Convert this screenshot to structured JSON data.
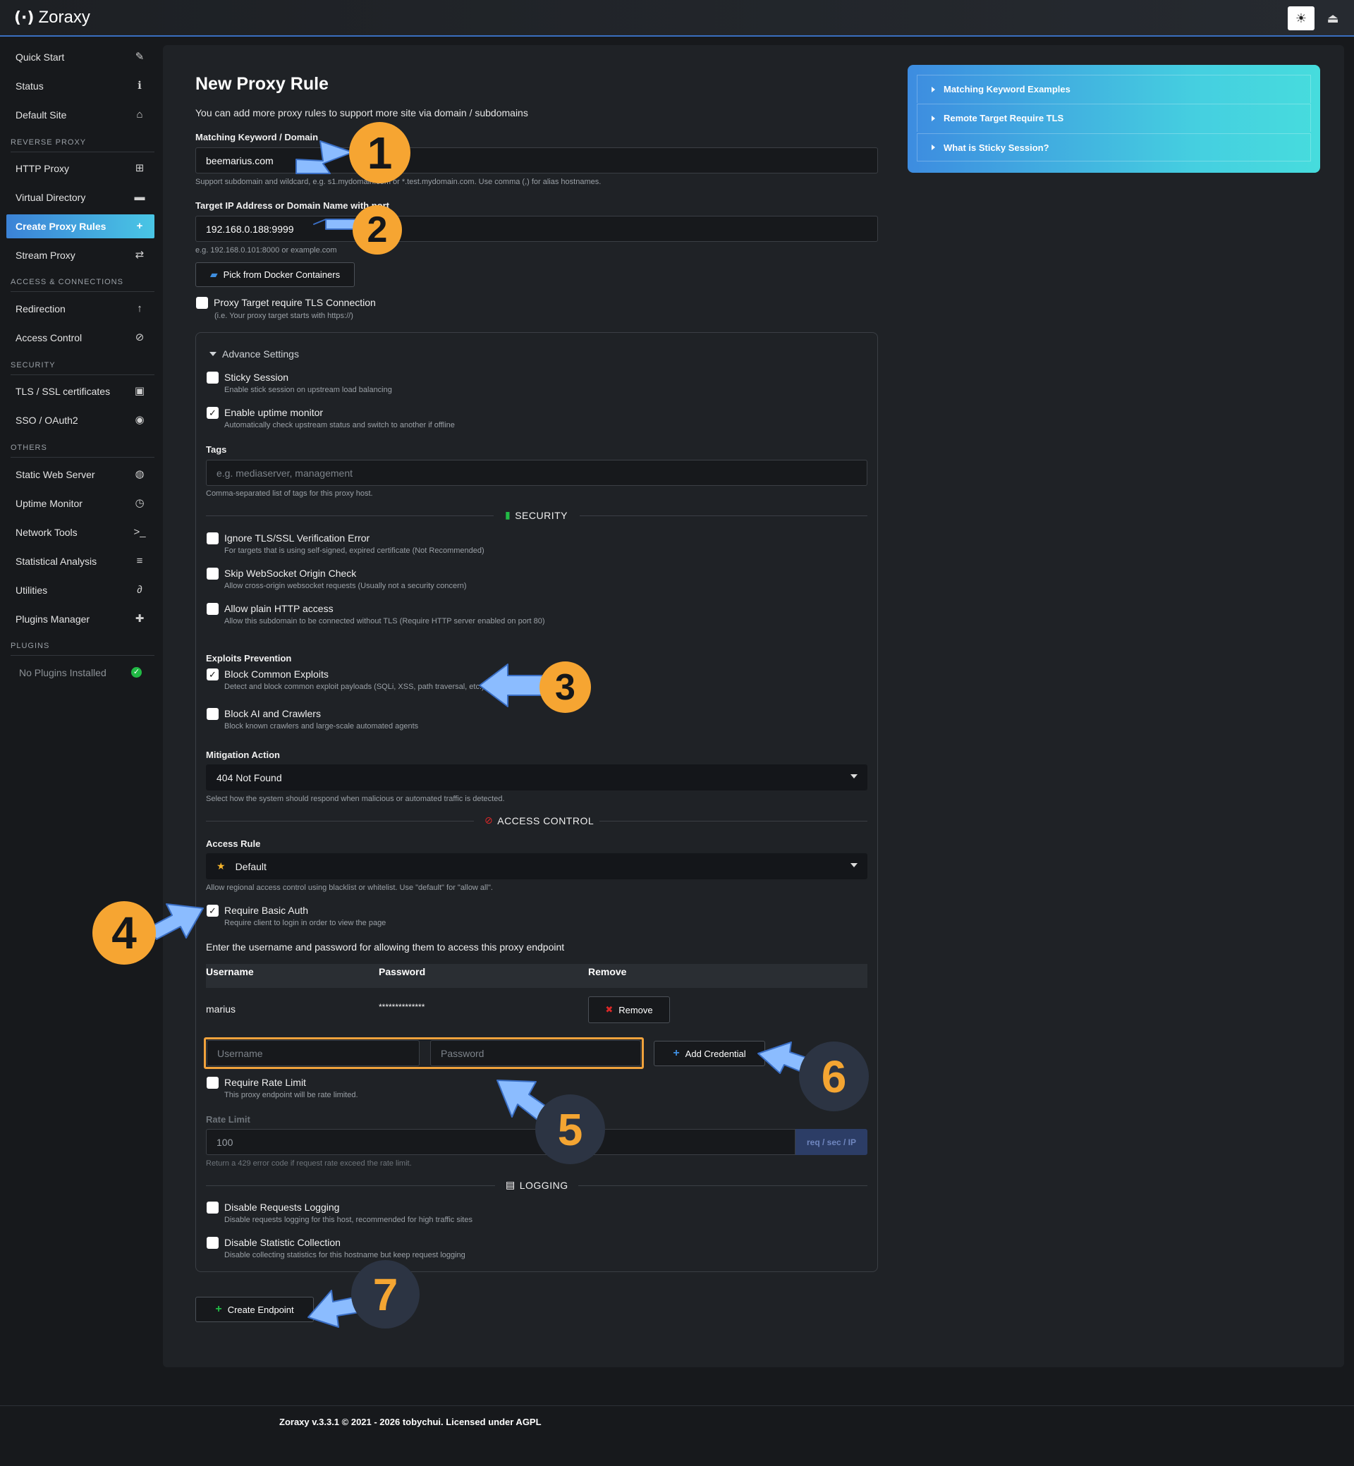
{
  "app": {
    "logo": "(·)",
    "name": "Zoraxy"
  },
  "header": {
    "theme_icon": "sun-icon",
    "logout_icon": "logout-icon"
  },
  "sidebar": {
    "items": [
      {
        "label": "Quick Start",
        "icon": "wand-icon",
        "glyph": "✎"
      },
      {
        "label": "Status",
        "icon": "info-icon",
        "glyph": "ℹ"
      },
      {
        "label": "Default Site",
        "icon": "home-icon",
        "glyph": "⌂"
      },
      {
        "label": "HTTP Proxy",
        "icon": "sitemap-icon",
        "glyph": "⊞"
      },
      {
        "label": "Virtual Directory",
        "icon": "folder-icon",
        "glyph": "▬"
      },
      {
        "label": "Create Proxy Rules",
        "icon": "plus-square-icon",
        "glyph": "+"
      },
      {
        "label": "Stream Proxy",
        "icon": "exchange-icon",
        "glyph": "⇄"
      },
      {
        "label": "Redirection",
        "icon": "level-up-icon",
        "glyph": "↑"
      },
      {
        "label": "Access Control",
        "icon": "ban-icon",
        "glyph": "⊘"
      },
      {
        "label": "TLS / SSL certificates",
        "icon": "lock-icon",
        "glyph": "▣"
      },
      {
        "label": "SSO / OAuth2",
        "icon": "user-circle-icon",
        "glyph": "◉"
      },
      {
        "label": "Static Web Server",
        "icon": "globe-icon",
        "glyph": "◍"
      },
      {
        "label": "Uptime Monitor",
        "icon": "clock-icon",
        "glyph": "◷"
      },
      {
        "label": "Network Tools",
        "icon": "terminal-icon",
        "glyph": ">_"
      },
      {
        "label": "Statistical Analysis",
        "icon": "database-icon",
        "glyph": "≡"
      },
      {
        "label": "Utilities",
        "icon": "paperclip-icon",
        "glyph": "∂"
      },
      {
        "label": "Plugins Manager",
        "icon": "puzzle-icon",
        "glyph": "✚"
      }
    ],
    "sections": [
      "REVERSE PROXY",
      "ACCESS & CONNECTIONS",
      "SECURITY",
      "OTHERS",
      "PLUGINS"
    ],
    "no_plugins": "No Plugins Installed"
  },
  "form": {
    "title": "New Proxy Rule",
    "subtitle": "You can add more proxy rules to support more site via domain / subdomains",
    "domain_label": "Matching Keyword / Domain",
    "domain_value": "beemarius.com",
    "domain_hint": "Support subdomain and wildcard, e.g. s1.mydomain.com or *.test.mydomain.com. Use comma (,) for alias hostnames.",
    "target_label": "Target IP Address or Domain Name with port",
    "target_value": "192.168.0.188:9999",
    "target_hint": "e.g. 192.168.0.101:8000 or example.com",
    "docker_button": "Pick from Docker Containers",
    "tls_label": "Proxy Target require TLS Connection",
    "tls_hint": "(i.e. Your proxy target starts with https://)",
    "advanced": {
      "header": "Advance Settings",
      "sticky_label": "Sticky Session",
      "sticky_hint": "Enable stick session on upstream load balancing",
      "uptime_label": "Enable uptime monitor",
      "uptime_hint": "Automatically check upstream status and switch to another if offline",
      "tags_label": "Tags",
      "tags_placeholder": "e.g. mediaserver, management",
      "tags_hint": "Comma-separated list of tags for this proxy host.",
      "security_title": "SECURITY",
      "ignore_tls_label": "Ignore TLS/SSL Verification Error",
      "ignore_tls_hint": "For targets that is using self-signed, expired certificate (Not Recommended)",
      "skip_ws_label": "Skip WebSocket Origin Check",
      "skip_ws_hint": "Allow cross-origin websocket requests (Usually not a security concern)",
      "plain_http_label": "Allow plain HTTP access",
      "plain_http_hint": "Allow this subdomain to be connected without TLS (Require HTTP server enabled on port 80)",
      "exploits_title": "Exploits Prevention",
      "block_exploits_label": "Block Common Exploits",
      "block_exploits_hint": "Detect and block common exploit payloads (SQLi, XSS, path traversal, etc.)",
      "block_ai_label": "Block AI and Crawlers",
      "block_ai_hint": "Block known crawlers and large-scale automated agents",
      "mitigation_label": "Mitigation Action",
      "mitigation_value": "404 Not Found",
      "mitigation_hint": "Select how the system should respond when malicious or automated traffic is detected.",
      "access_title": "ACCESS CONTROL",
      "access_rule_label": "Access Rule",
      "access_rule_value": "Default",
      "access_rule_hint": "Allow regional access control using blacklist or whitelist. Use \"default\" for \"allow all\".",
      "basic_auth_label": "Require Basic Auth",
      "basic_auth_hint": "Require client to login in order to view the page",
      "cred_intro": "Enter the username and password for allowing them to access this proxy endpoint",
      "cred_headers": [
        "Username",
        "Password",
        "Remove"
      ],
      "cred_rows": [
        {
          "username": "marius",
          "password": "**************",
          "remove": "Remove"
        }
      ],
      "username_placeholder": "Username",
      "password_placeholder": "Password",
      "add_credential": "Add Credential",
      "rate_limit_label": "Require Rate Limit",
      "rate_limit_hint": "This proxy endpoint will be rate limited.",
      "rate_label": "Rate Limit",
      "rate_value": "100",
      "rate_unit": "req / sec / IP",
      "rate_hint": "Return a 429 error code if request rate exceed the rate limit.",
      "logging_title": "LOGGING",
      "disable_logging_label": "Disable Requests Logging",
      "disable_logging_hint": "Disable requests logging for this host, recommended for high traffic sites",
      "disable_stats_label": "Disable Statistic Collection",
      "disable_stats_hint": "Disable collecting statistics for this hostname but keep request logging"
    },
    "create_button": "Create Endpoint"
  },
  "checkboxes": {
    "tls": false,
    "sticky": false,
    "uptime": true,
    "ignore_tls": false,
    "skip_ws": false,
    "plain_http": false,
    "block_exploits": true,
    "block_ai": false,
    "basic_auth": true,
    "rate_limit": false,
    "disable_logging": false,
    "disable_stats": false
  },
  "faq": [
    "Matching Keyword Examples",
    "Remote Target Require TLS",
    "What is Sticky Session?"
  ],
  "annotations": [
    "1",
    "2",
    "3",
    "4",
    "5",
    "6",
    "7"
  ],
  "footer": "Zoraxy v.3.3.1 © 2021 - 2026 tobychui. Licensed under AGPL",
  "colors": {
    "accent": "#3b82d6",
    "annotation_orange": "#f6a532",
    "annotation_arrow": "#7fb4ff",
    "highlight_box": "#f0a23c"
  }
}
